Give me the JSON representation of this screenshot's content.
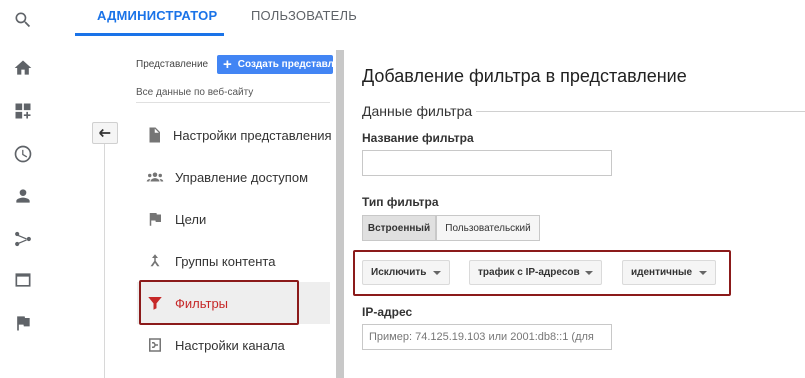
{
  "tabs": {
    "admin": "АДМИНИСТРАТОР",
    "user": "ПОЛЬЗОВАТЕЛЬ"
  },
  "rail": {
    "icons": [
      "search-icon",
      "home-icon",
      "customization-icon",
      "realtime-icon",
      "audience-icon",
      "acquisition-icon",
      "behavior-icon",
      "conversions-icon"
    ]
  },
  "view": {
    "label": "Представление",
    "create_button": "Создать представление",
    "selected": "Все данные по веб-сайту"
  },
  "menu": {
    "items": [
      {
        "label": "Настройки представления",
        "icon": "document-icon"
      },
      {
        "label": "Управление доступом",
        "icon": "people-icon"
      },
      {
        "label": "Цели",
        "icon": "flag-icon"
      },
      {
        "label": "Группы контента",
        "icon": "content-groups-icon"
      },
      {
        "label": "Фильтры",
        "icon": "filter-icon",
        "active": true
      },
      {
        "label": "Настройки канала",
        "icon": "channel-settings-icon"
      }
    ]
  },
  "form": {
    "title": "Добавление фильтра в представление",
    "section": "Данные фильтра",
    "name_label": "Название фильтра",
    "name_value": "",
    "type_label": "Тип фильтра",
    "type_builtin": "Встроенный",
    "type_custom": "Пользовательский",
    "dropdown_1": "Исключить",
    "dropdown_2": "трафик с IP-адресов",
    "dropdown_3": "идентичные",
    "ip_label": "IP-адрес",
    "ip_placeholder": "Пример: 74.125.19.103 или 2001:db8::1 (для"
  },
  "colors": {
    "accent": "#1a73e8",
    "create_button": "#4285f4",
    "highlight_border": "#8b1a1a",
    "active_menu_text": "#c62828"
  }
}
